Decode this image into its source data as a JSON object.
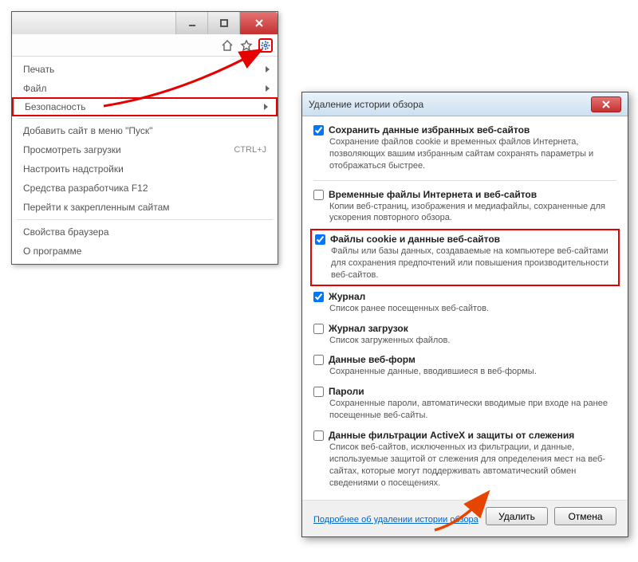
{
  "menu": {
    "items": [
      {
        "label": "Печать",
        "has_submenu": true,
        "shortcut": ""
      },
      {
        "label": "Файл",
        "has_submenu": true,
        "shortcut": ""
      },
      {
        "label": "Безопасность",
        "has_submenu": true,
        "shortcut": "",
        "highlighted": true
      },
      {
        "label": "Добавить сайт в меню \"Пуск\"",
        "has_submenu": false,
        "shortcut": ""
      },
      {
        "label": "Просмотреть загрузки",
        "has_submenu": false,
        "shortcut": "CTRL+J"
      },
      {
        "label": "Настроить надстройки",
        "has_submenu": false,
        "shortcut": ""
      },
      {
        "label": "Средства разработчика F12",
        "has_submenu": false,
        "shortcut": ""
      },
      {
        "label": "Перейти к закрепленным сайтам",
        "has_submenu": false,
        "shortcut": ""
      },
      {
        "label": "Свойства браузера",
        "has_submenu": false,
        "shortcut": ""
      },
      {
        "label": "О программе",
        "has_submenu": false,
        "shortcut": ""
      }
    ]
  },
  "dialog": {
    "title": "Удаление истории обзора",
    "items": [
      {
        "checked": true,
        "title": "Сохранить данные избранных веб-сайтов",
        "desc": "Сохранение файлов cookie и временных файлов Интернета, позволяющих вашим избранным сайтам сохранять параметры и отображаться быстрее."
      },
      {
        "checked": false,
        "title": "Временные файлы Интернета и веб-сайтов",
        "desc": "Копии веб-страниц, изображения и медиафайлы, сохраненные для ускорения повторного обзора."
      },
      {
        "checked": true,
        "title": "Файлы cookie и данные веб-сайтов",
        "desc": "Файлы или базы данных, создаваемые на компьютере веб-сайтами для сохранения предпочтений или повышения производительности веб-сайтов.",
        "highlighted": true
      },
      {
        "checked": true,
        "title": "Журнал",
        "desc": "Список ранее посещенных веб-сайтов."
      },
      {
        "checked": false,
        "title": "Журнал загрузок",
        "desc": "Список загруженных файлов."
      },
      {
        "checked": false,
        "title": "Данные веб-форм",
        "desc": "Сохраненные данные, вводившиеся в веб-формы."
      },
      {
        "checked": false,
        "title": "Пароли",
        "desc": "Сохраненные пароли, автоматически вводимые при входе на ранее посещенные веб-сайты."
      },
      {
        "checked": false,
        "title": "Данные фильтрации ActiveX и защиты от слежения",
        "desc": "Список веб-сайтов, исключенных из фильтрации, и данные, используемые защитой от слежения для определения мест на веб-сайтах, которые могут поддерживать автоматический обмен сведениями о посещениях."
      }
    ],
    "link": "Подробнее об удалении истории обзора",
    "delete_label": "Удалить",
    "cancel_label": "Отмена"
  }
}
